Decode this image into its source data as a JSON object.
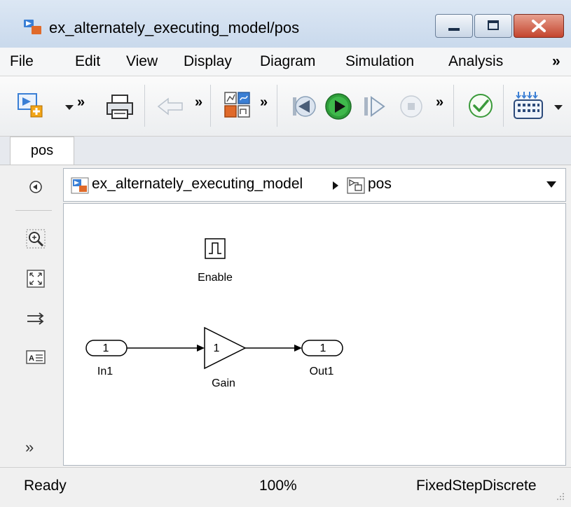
{
  "window": {
    "title": "ex_alternately_executing_model/pos"
  },
  "menu": {
    "items": [
      "File",
      "Edit",
      "View",
      "Display",
      "Diagram",
      "Simulation",
      "Analysis"
    ],
    "overflow": "»"
  },
  "toolbar": {
    "overflow": "»"
  },
  "tabs": [
    {
      "label": "pos",
      "active": true
    }
  ],
  "breadcrumb": {
    "model": "ex_alternately_executing_model",
    "subsystem": "pos"
  },
  "diagram": {
    "enable_label": "Enable",
    "inport": {
      "number": "1",
      "label": "In1"
    },
    "gain": {
      "value": "1",
      "label": "Gain"
    },
    "outport": {
      "number": "1",
      "label": "Out1"
    }
  },
  "palette": {
    "expand": "»"
  },
  "status": {
    "state": "Ready",
    "zoom": "100%",
    "solver": "FixedStepDiscrete"
  },
  "colors": {
    "accent_blue": "#3a7fd5",
    "run_green": "#2e9d3a",
    "title_bar": "#c9d9ec",
    "close_red": "#c4452e"
  }
}
